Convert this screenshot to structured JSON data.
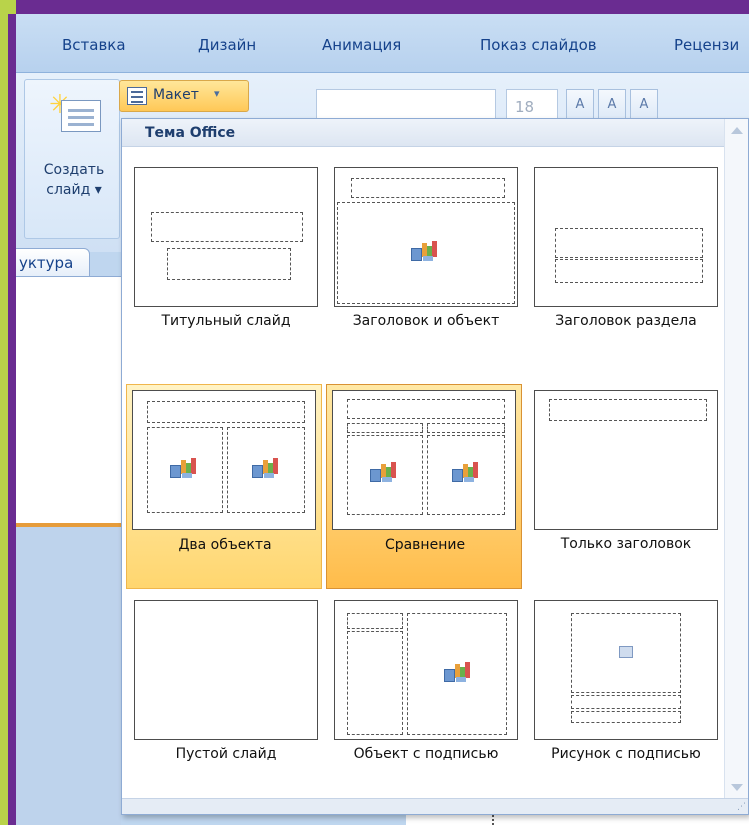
{
  "ribbon": {
    "tabs": [
      "Вставка",
      "Дизайн",
      "Анимация",
      "Показ слайдов",
      "Рецензи"
    ],
    "new_slide_label_1": "Создать",
    "new_slide_label_2": "слайд ▾",
    "layout_button": "Макет",
    "layout_arrow": "▾",
    "font_size": "18",
    "btn_grow": "A",
    "btn_shrink": "A",
    "btn_clear": "A"
  },
  "panel": {
    "tab_label": "уктура"
  },
  "dropdown": {
    "title": "Тема Office",
    "layouts": [
      {
        "label": "Титульный слайд"
      },
      {
        "label": "Заголовок и объект"
      },
      {
        "label": "Заголовок раздела"
      },
      {
        "label": "Два объекта"
      },
      {
        "label": "Сравнение"
      },
      {
        "label": "Только заголовок"
      },
      {
        "label": "Пустой слайд"
      },
      {
        "label": "Объект с подписью"
      },
      {
        "label": "Рисунок с подписью"
      }
    ]
  }
}
